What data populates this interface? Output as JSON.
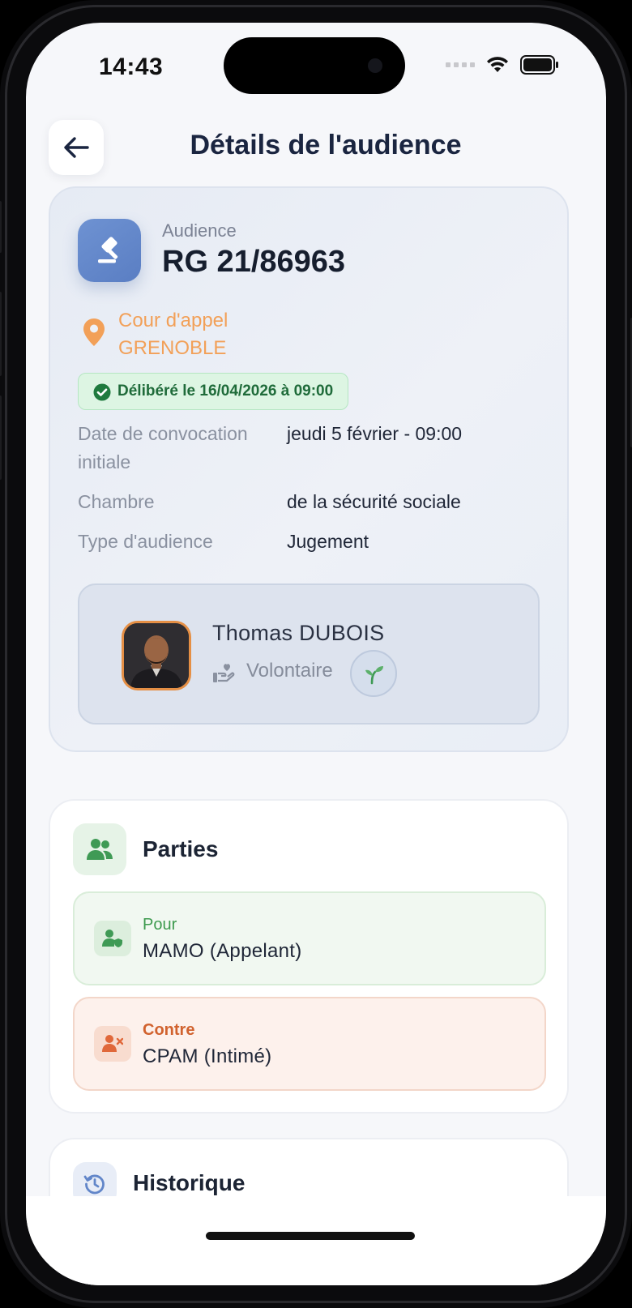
{
  "status_bar": {
    "time": "14:43"
  },
  "header": {
    "title": "Détails de l'audience"
  },
  "hearing": {
    "label": "Audience",
    "number": "RG 21/86963",
    "court_line1": "Cour d'appel",
    "court_line2": "GRENOBLE",
    "deliberation": "Délibéré le 16/04/2026 à 09:00",
    "details": [
      {
        "label": "Date de convocation initiale",
        "value": "jeudi 5 février - 09:00"
      },
      {
        "label": "Chambre",
        "value": "de la sécurité sociale"
      },
      {
        "label": "Type d'audience",
        "value": "Jugement"
      }
    ],
    "lawyer": {
      "name": "Thomas DUBOIS",
      "role": "Volontaire"
    }
  },
  "parties": {
    "title": "Parties",
    "for": {
      "side": "Pour",
      "name": "MAMO (Appelant)"
    },
    "against": {
      "side": "Contre",
      "name": "CPAM (Intimé)"
    }
  },
  "history": {
    "title": "Historique"
  },
  "colors": {
    "accent_blue": "#6286c9",
    "court_orange": "#f2a058",
    "for_green": "#3d9a4e",
    "against_orange": "#d1622e"
  }
}
